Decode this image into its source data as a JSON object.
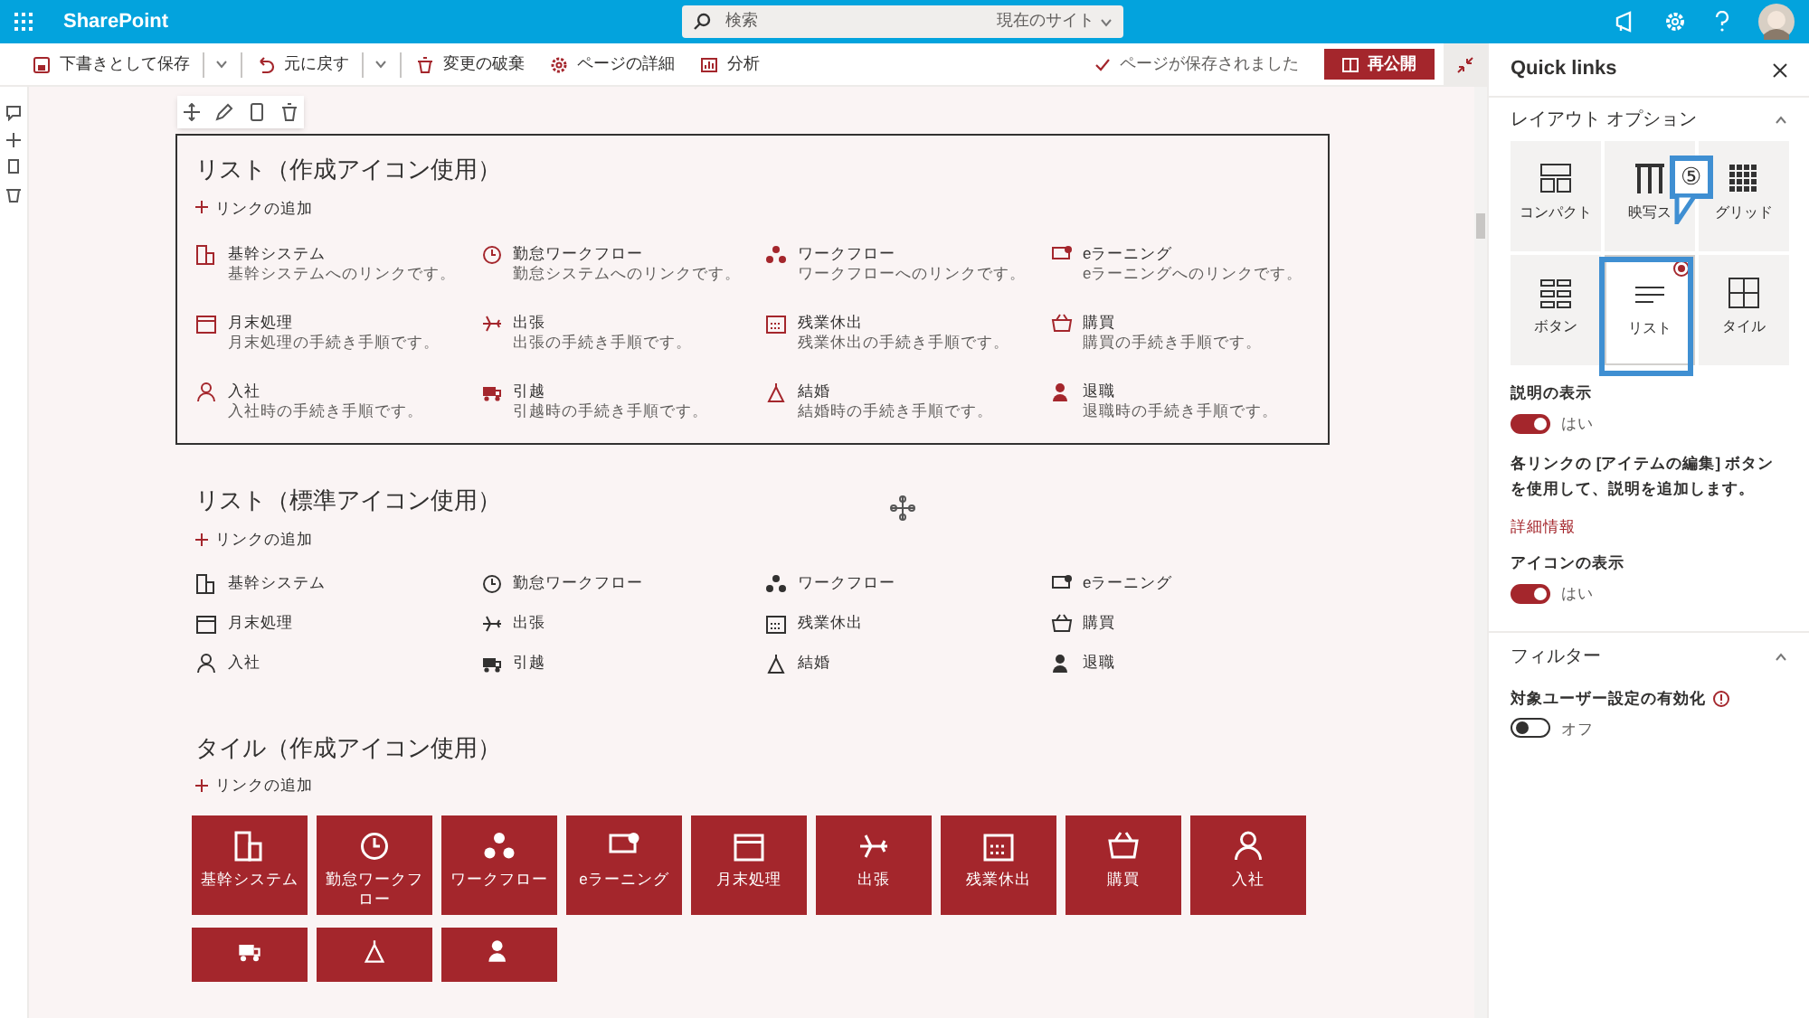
{
  "suite_bar": {
    "app_name": "SharePoint",
    "search": {
      "placeholder": "検索",
      "scope": "現在のサイト"
    }
  },
  "command_bar": {
    "items": [
      {
        "label": "下書きとして保存",
        "dropdown": true
      },
      {
        "label": "元に戻す",
        "dropdown": true
      },
      {
        "label": "変更の破棄",
        "dropdown": false
      },
      {
        "label": "ページの詳細",
        "dropdown": false
      },
      {
        "label": "分析",
        "dropdown": false
      }
    ],
    "status": "ページが保存されました",
    "publish_button": "再公開"
  },
  "sections": [
    {
      "kind": "list",
      "title": "リスト（作成アイコン使用）",
      "add_link": "リンクの追加",
      "selected": true,
      "show_descriptions": true,
      "items": [
        {
          "title": "基幹システム",
          "description": "基幹システムへのリンクです。"
        },
        {
          "title": "勤怠ワークフロー",
          "description": "勤怠システムへのリンクです。"
        },
        {
          "title": "ワークフロー",
          "description": "ワークフローへのリンクです。"
        },
        {
          "title": "eラーニング",
          "description": "eラーニングへのリンクです。"
        },
        {
          "title": "月末処理",
          "description": "月末処理の手続き手順です。"
        },
        {
          "title": "出張",
          "description": "出張の手続き手順です。"
        },
        {
          "title": "残業休出",
          "description": "残業休出の手続き手順です。"
        },
        {
          "title": "購買",
          "description": "購買の手続き手順です。"
        },
        {
          "title": "入社",
          "description": "入社時の手続き手順です。"
        },
        {
          "title": "引越",
          "description": "引越時の手続き手順です。"
        },
        {
          "title": "結婚",
          "description": "結婚時の手続き手順です。"
        },
        {
          "title": "退職",
          "description": "退職時の手続き手順です。"
        }
      ]
    },
    {
      "kind": "list",
      "title": "リスト（標準アイコン使用）",
      "add_link": "リンクの追加",
      "selected": false,
      "show_descriptions": false,
      "items": [
        {
          "title": "基幹システム"
        },
        {
          "title": "勤怠ワークフロー"
        },
        {
          "title": "ワークフロー"
        },
        {
          "title": "eラーニング"
        },
        {
          "title": "月末処理"
        },
        {
          "title": "出張"
        },
        {
          "title": "残業休出"
        },
        {
          "title": "購買"
        },
        {
          "title": "入社"
        },
        {
          "title": "引越"
        },
        {
          "title": "結婚"
        },
        {
          "title": "退職"
        }
      ]
    },
    {
      "kind": "tiles",
      "title": "タイル（作成アイコン使用）",
      "add_link": "リンクの追加",
      "selected": false,
      "items": [
        {
          "title": "基幹システム"
        },
        {
          "title": "勤怠ワークフロー"
        },
        {
          "title": "ワークフロー"
        },
        {
          "title": "eラーニング"
        },
        {
          "title": "月末処理"
        },
        {
          "title": "出張"
        },
        {
          "title": "残業休出"
        },
        {
          "title": "購買"
        },
        {
          "title": "入社"
        },
        {
          "kind": "cut"
        },
        {
          "kind": "cut"
        },
        {
          "kind": "cut"
        }
      ]
    }
  ],
  "panel": {
    "title": "Quick links",
    "layout_group": {
      "title": "レイアウト オプション",
      "expanded": true,
      "options": [
        {
          "label": "コンパクト",
          "selected": false
        },
        {
          "label": "映写ス",
          "selected": false
        },
        {
          "label": "グリッド",
          "selected": false
        },
        {
          "label": "ボタン",
          "selected": false
        },
        {
          "label": "リスト",
          "selected": true
        },
        {
          "label": "タイル",
          "selected": false
        }
      ]
    },
    "settings": [
      {
        "kind": "toggle",
        "label": "説明の表示",
        "on": true,
        "state_text": "はい"
      },
      {
        "kind": "note",
        "text": "各リンクの [アイテムの編集] ボタンを使用して、説明を追加します。"
      },
      {
        "kind": "link",
        "text": "詳細情報"
      },
      {
        "kind": "toggle",
        "label": "アイコンの表示",
        "on": true,
        "state_text": "はい"
      }
    ],
    "filter_group": {
      "title": "フィルター",
      "expanded": true,
      "settings": [
        {
          "kind": "toggle",
          "label": "対象ユーザー設定の有効化",
          "info": true,
          "on": false,
          "state_text": "オフ"
        }
      ]
    }
  },
  "callout": {
    "label": "⑤"
  }
}
